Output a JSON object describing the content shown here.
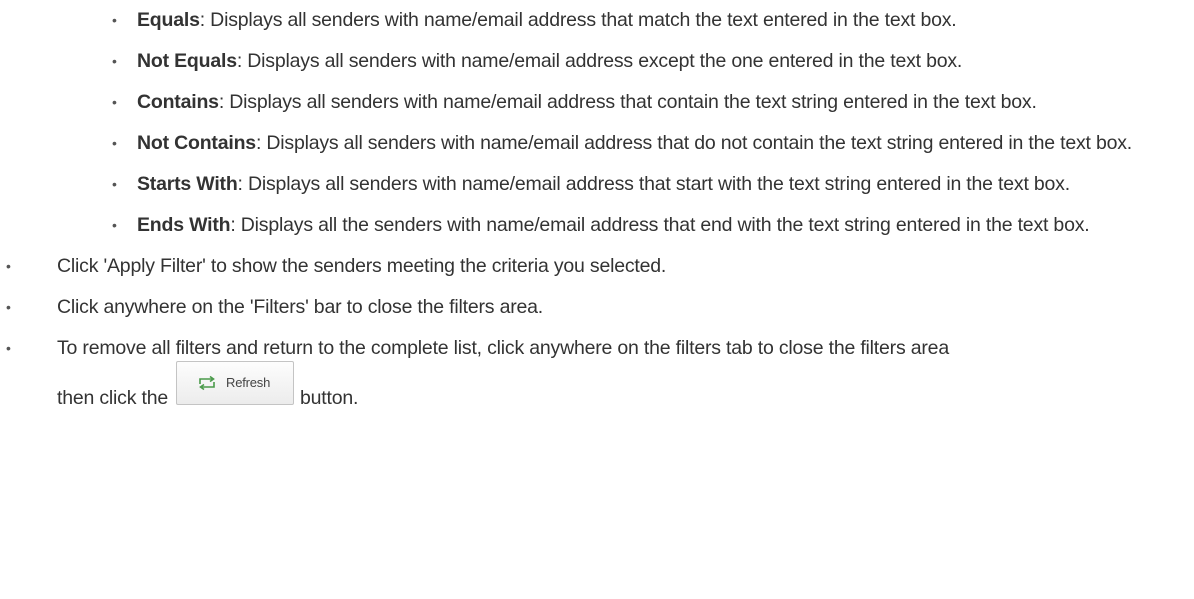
{
  "bullet_char": "•",
  "filter_options": [
    {
      "term": "Equals",
      "text": ": Displays all senders with name/email address that match the text entered in the text box."
    },
    {
      "term": "Not Equals",
      "text": ": Displays all senders with name/email address except the one entered in the text box."
    },
    {
      "term": "Contains",
      "text": ": Displays all senders with name/email address that contain the text string entered in the text box."
    },
    {
      "term": "Not Contains",
      "text": ": Displays all senders with name/email address that do not contain the text string entered in the text box."
    },
    {
      "term": "Starts With",
      "text": ": Displays all senders with name/email address that start with the text string entered in the text box."
    },
    {
      "term": "Ends With",
      "text": ": Displays all the senders with name/email address that end with the text string entered in the text box."
    }
  ],
  "steps": [
    "Click 'Apply Filter' to show the senders meeting the criteria you selected.",
    "Click anywhere on the 'Filters' bar to close the filters area.",
    "To remove all filters and return to the complete list, click anywhere on the filters tab to close the filters area"
  ],
  "refresh_line": {
    "before": "then click the",
    "button_label": "Refresh",
    "button_icon": "refresh-icon",
    "after": "button."
  }
}
